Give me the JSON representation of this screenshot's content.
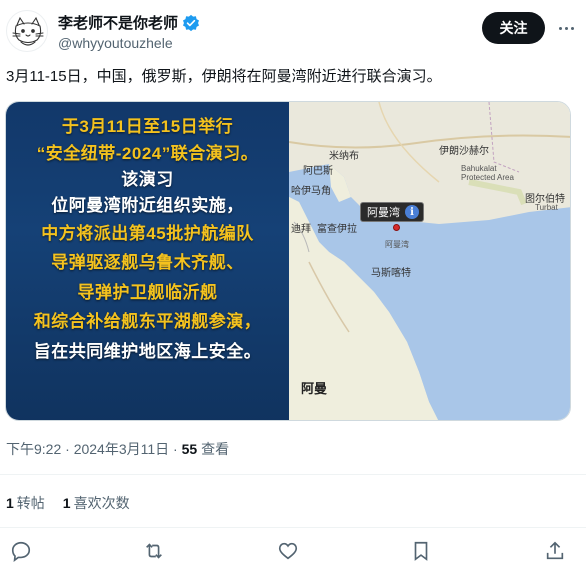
{
  "author": {
    "display_name": "李老师不是你老师",
    "handle": "@whyyoutouzhele",
    "verified": true,
    "avatar_icon": "cat-sketch-avatar"
  },
  "follow_label": "关注",
  "tweet": {
    "text": "3月11-15日，中国，俄罗斯，伊朗将在阿曼湾附近进行联合演习。"
  },
  "poster": {
    "lines": [
      "于3月11日至15日举行",
      "“安全纽带-2024”联合演习。",
      "该演习",
      "位阿曼湾附近组织实施，",
      "中方将派出第45批护航编队",
      "导弹驱逐舰乌鲁木齐舰、",
      "导弹护卫舰临沂舰",
      "和综合补给舰东平湖舰参演，",
      "旨在共同维护地区海上安全。"
    ]
  },
  "map": {
    "callout": "阿曼湾",
    "labels": {
      "iran_east": "伊朗沙赫尔",
      "bahukalat": "Bahukalat",
      "bahukalat_sub": "Protected Area",
      "turbat": "图尔伯特",
      "turbat_en": "Turbat",
      "minab": "米纳布",
      "bandar": "阿巴斯",
      "dubai": "哈伊马角",
      "fujairah": "富查伊拉",
      "dubai2": "迪拜",
      "gulf_label": "阿曼湾",
      "muscat": "马斯喀特",
      "oman": "阿曼"
    }
  },
  "meta": {
    "time": "下午9:22",
    "date": "2024年3月11日",
    "separator": " · ",
    "views_count": "55",
    "views_label": " 查看"
  },
  "stats": {
    "retweets_count": "1",
    "retweets_label": "转帖",
    "likes_count": "1",
    "likes_label": "喜欢次数"
  },
  "colors": {
    "poster_bg": "#12386a",
    "poster_yellow": "#f4c21e",
    "follow_bg": "#0f1419",
    "verified": "#1d9bf0",
    "secondary_text": "#536471"
  }
}
